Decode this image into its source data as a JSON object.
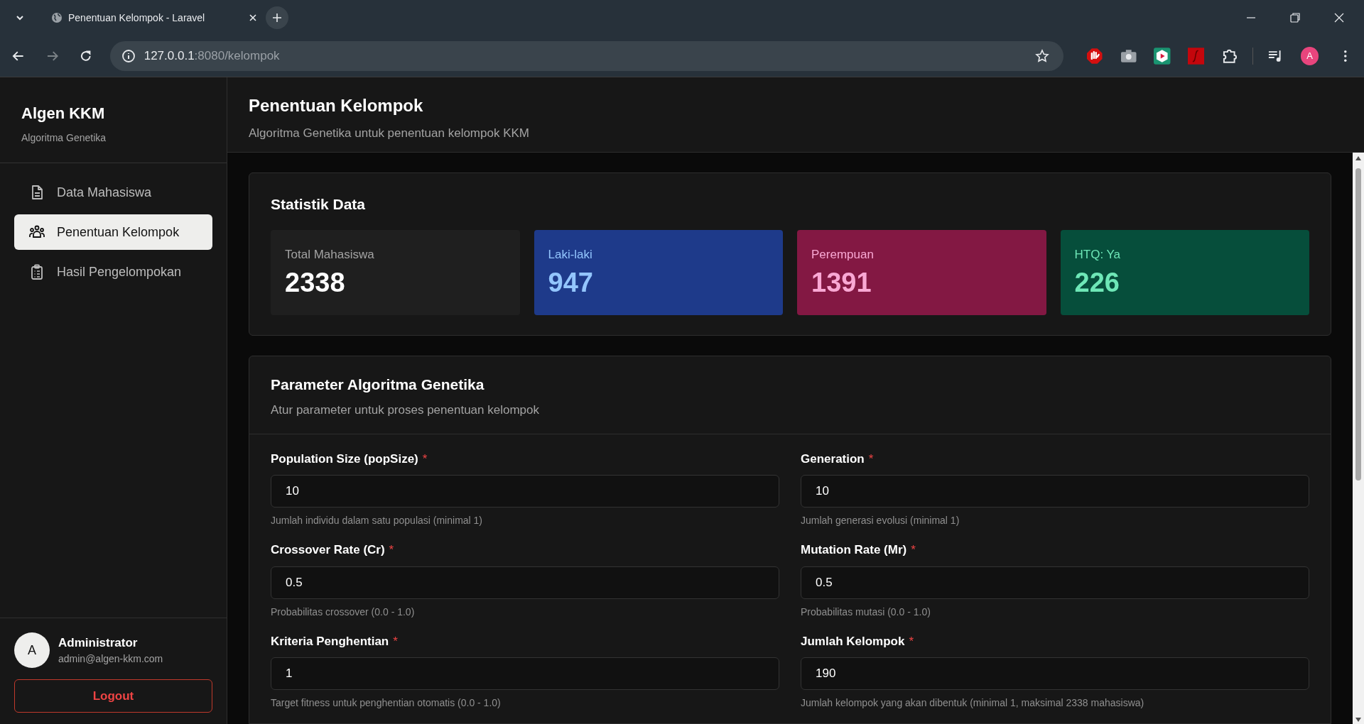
{
  "browser": {
    "tab_title": "Penentuan Kelompok - Laravel",
    "url_host": "127.0.0.1",
    "url_path": ":8080/kelompok",
    "profile_initial": "A"
  },
  "sidebar": {
    "brand": "Algen KKM",
    "subtitle": "Algoritma Genetika",
    "items": [
      {
        "label": "Data Mahasiswa",
        "kind": "document",
        "selected": false
      },
      {
        "label": "Penentuan Kelompok",
        "kind": "users",
        "selected": true
      },
      {
        "label": "Hasil Pengelompokan",
        "kind": "clipboard",
        "selected": false
      }
    ],
    "user": {
      "initial": "A",
      "name": "Administrator",
      "email": "admin@algen-kkm.com"
    },
    "logout": "Logout"
  },
  "header": {
    "title": "Penentuan Kelompok",
    "subtitle": "Algoritma Genetika untuk penentuan kelompok KKM"
  },
  "stats": {
    "title": "Statistik Data",
    "cards": [
      {
        "label": "Total Mahasiswa",
        "value": "2338",
        "color": "#1f1f1f"
      },
      {
        "label": "Laki-laki",
        "value": "947",
        "color": "#1e3a8a"
      },
      {
        "label": "Perempuan",
        "value": "1391",
        "color": "#831843"
      },
      {
        "label": "HTQ: Ya",
        "value": "226",
        "color": "#064e3b"
      }
    ]
  },
  "parameters": {
    "title": "Parameter Algoritma Genetika",
    "subtitle": "Atur parameter untuk proses penentuan kelompok",
    "fields": [
      {
        "label": "Population Size (popSize)",
        "required": "*",
        "value": "10",
        "help": "Jumlah individu dalam satu populasi (minimal 1)"
      },
      {
        "label": "Generation",
        "required": "*",
        "value": "10",
        "help": "Jumlah generasi evolusi (minimal 1)"
      },
      {
        "label": "Crossover Rate (Cr)",
        "required": "*",
        "value": "0.5",
        "help": "Probabilitas crossover (0.0 - 1.0)"
      },
      {
        "label": "Mutation Rate (Mr)",
        "required": "*",
        "value": "0.5",
        "help": "Probabilitas mutasi (0.0 - 1.0)"
      },
      {
        "label": "Kriteria Penghentian",
        "required": "*",
        "value": "1",
        "help": "Target fitness untuk penghentian otomatis (0.0 - 1.0)"
      },
      {
        "label": "Jumlah Kelompok",
        "required": "*",
        "value": "190",
        "help": "Jumlah kelompok yang akan dibentuk (minimal 1, maksimal 2338 mahasiswa)"
      }
    ]
  }
}
